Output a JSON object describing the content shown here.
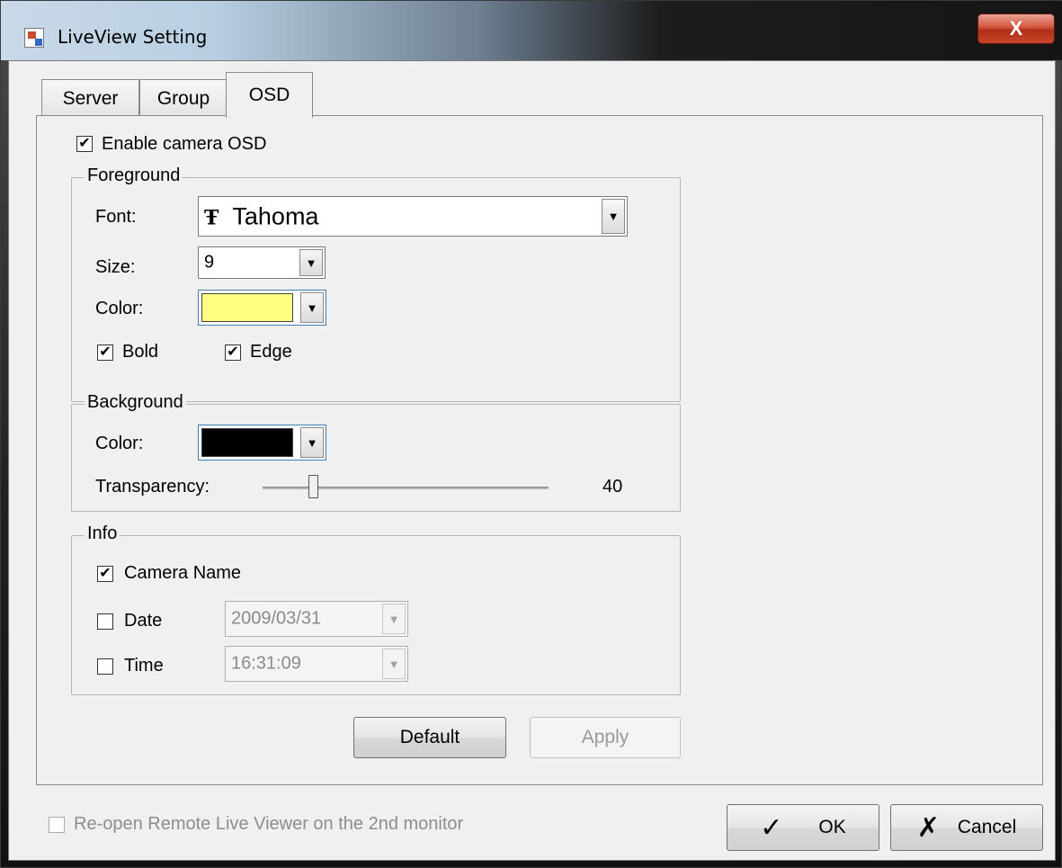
{
  "window": {
    "title": "LiveView Setting",
    "close_glyph": "X"
  },
  "tabs": [
    {
      "label": "Server",
      "active": false
    },
    {
      "label": "Group",
      "active": false
    },
    {
      "label": "OSD",
      "active": true
    }
  ],
  "osd": {
    "enable_label": "Enable camera OSD",
    "enable_checked": true,
    "foreground": {
      "title": "Foreground",
      "font_label": "Font:",
      "font_icon": "truetype-font-icon",
      "font_icon_glyph": "Ŧ",
      "font_value": "Tahoma",
      "size_label": "Size:",
      "size_value": "9",
      "color_label": "Color:",
      "color_value": "#ffff80",
      "bold_label": "Bold",
      "bold_checked": true,
      "edge_label": "Edge",
      "edge_checked": true
    },
    "background": {
      "title": "Background",
      "color_label": "Color:",
      "color_value": "#000000",
      "transparency_label": "Transparency:",
      "transparency_value": "40",
      "transparency_fraction": 0.18
    },
    "info": {
      "title": "Info",
      "camera_name_label": "Camera Name",
      "camera_name_checked": true,
      "date_label": "Date",
      "date_checked": false,
      "date_value": "2009/03/31",
      "time_label": "Time",
      "time_checked": false,
      "time_value": "16:31:09"
    },
    "default_button": "Default",
    "apply_button": "Apply"
  },
  "footer": {
    "reopen_label": "Re-open Remote Live Viewer on the 2nd monitor",
    "reopen_checked": false,
    "ok_button": "OK",
    "ok_icon": "checkmark-icon",
    "cancel_button": "Cancel",
    "cancel_icon": "x-icon"
  },
  "glyphs": {
    "check": "✔",
    "dropdown": "▼"
  }
}
